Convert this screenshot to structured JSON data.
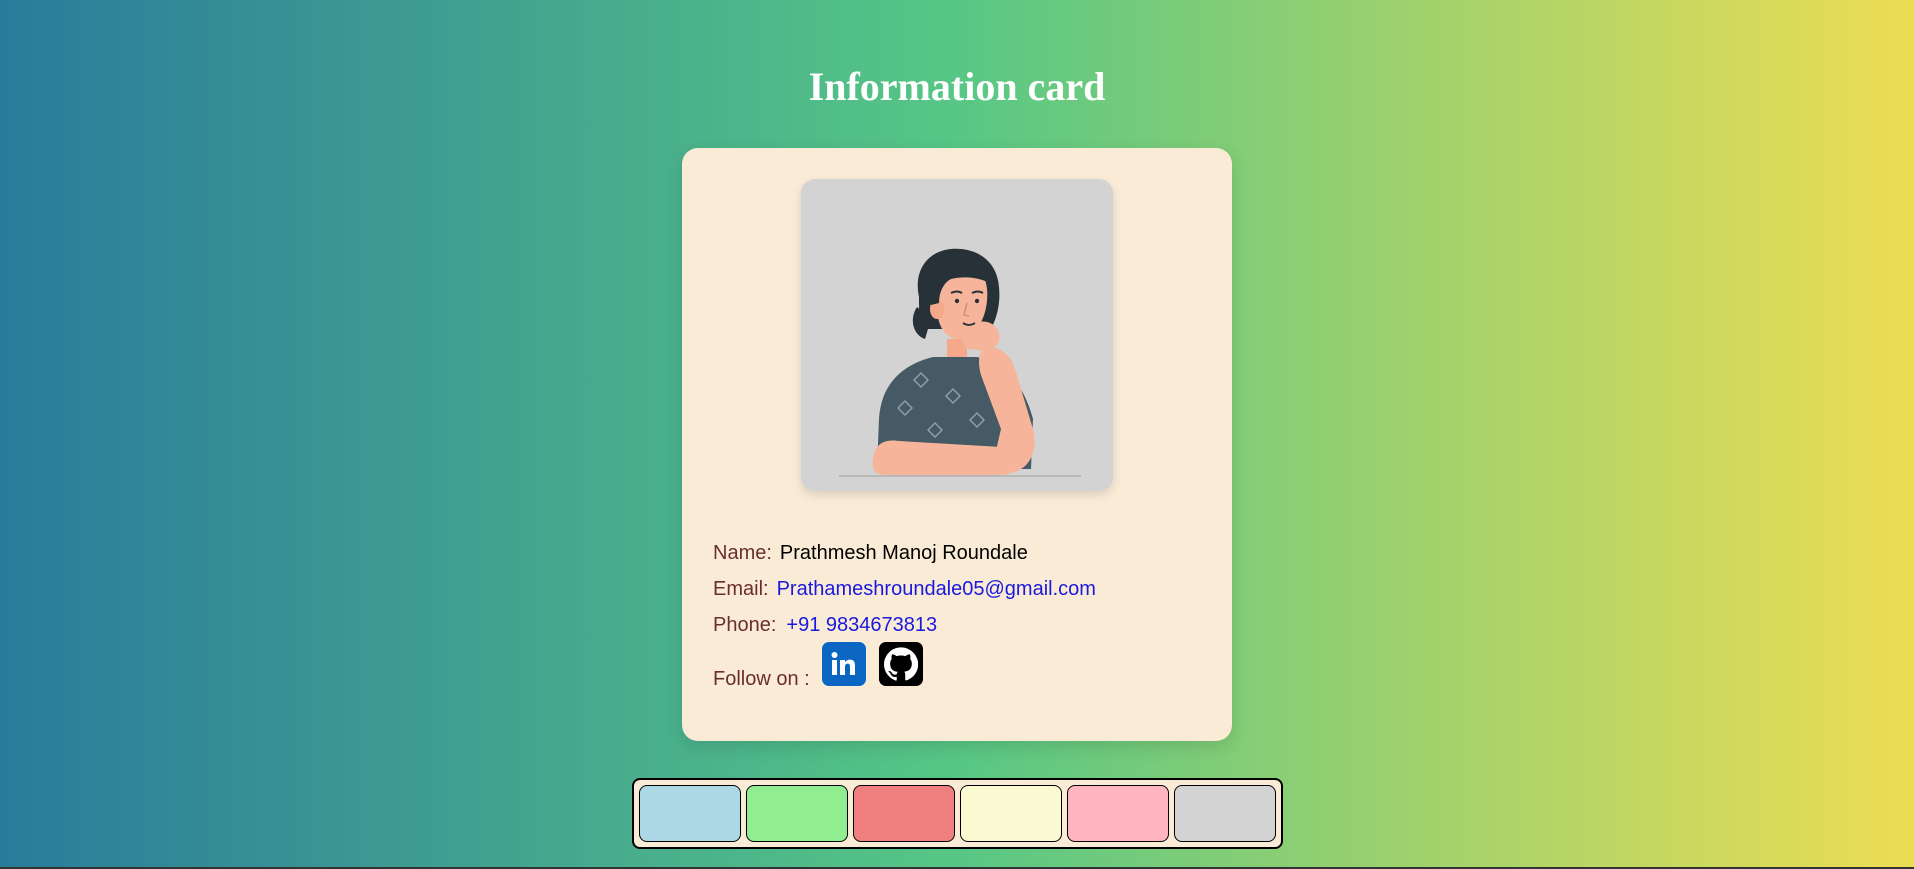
{
  "page": {
    "title": "Information card"
  },
  "card": {
    "avatar_icon": "person-thinking-illustration",
    "name_label": "Name:",
    "name_value": "Prathmesh Manoj Roundale",
    "email_label": "Email:",
    "email_value": "Prathameshroundale05@gmail.com",
    "phone_label": "Phone:",
    "phone_value": "+91 9834673813",
    "follow_label": "Follow on :",
    "social": [
      {
        "icon": "linkedin-icon",
        "color": "#0a66c2"
      },
      {
        "icon": "github-icon",
        "color": "#000000"
      }
    ]
  },
  "colors": {
    "gradient": [
      "#2a7b9b",
      "#57c785",
      "#eddd53"
    ],
    "card_background": "#faebd7",
    "label": "#6b2e2e",
    "link": "#1a1adc"
  },
  "swatches": [
    {
      "color": "#add8e6"
    },
    {
      "color": "#90ee90"
    },
    {
      "color": "#f08080"
    },
    {
      "color": "#fafad2"
    },
    {
      "color": "#ffb6c1"
    },
    {
      "color": "#d3d3d3"
    }
  ]
}
